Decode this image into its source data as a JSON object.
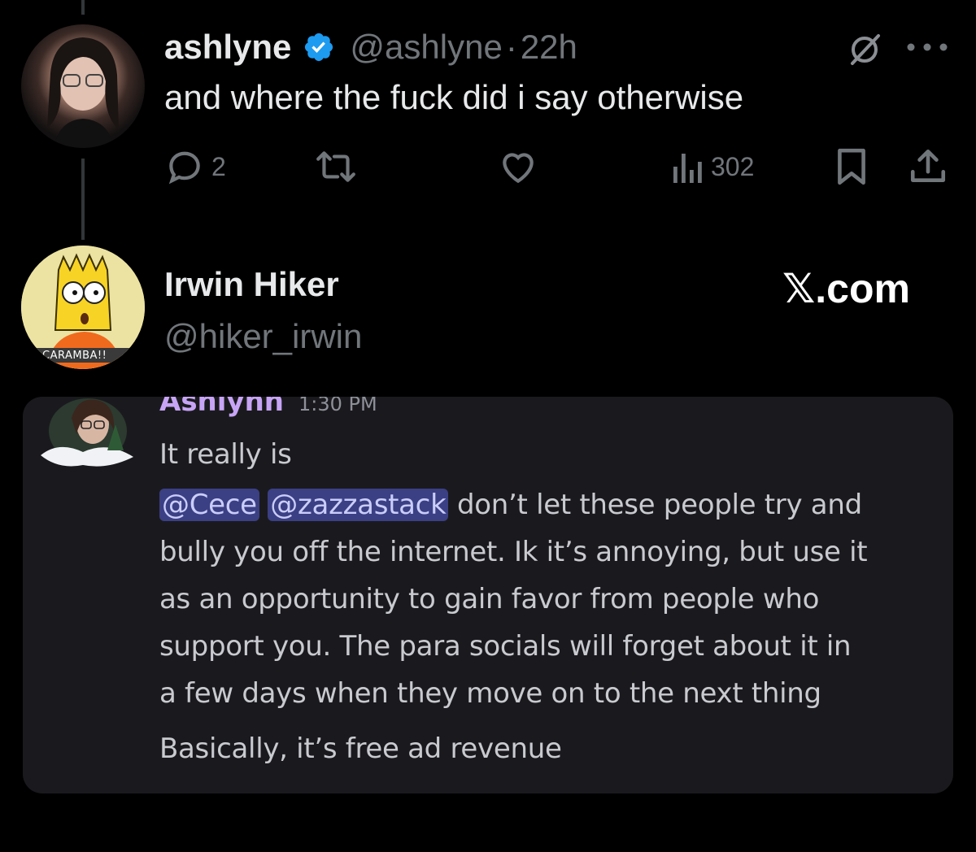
{
  "tweet": {
    "display_name": "ashlyne",
    "handle": "@ashlyne",
    "separator": "·",
    "time": "22h",
    "text": "and where the fuck did i say otherwise",
    "reply_count": "2",
    "view_count": "302",
    "verified": true,
    "colors": {
      "verified": "#1d9bf0",
      "muted": "#71767b",
      "text": "#e7e9ea"
    }
  },
  "embedded": {
    "display_name": "Irwin Hiker",
    "handle": "@hiker_irwin",
    "brand": "𝕏.com",
    "avatar_caption": "CARAMBA!!"
  },
  "discord": {
    "author": "Ashlynn",
    "timestamp": "1:30 PM",
    "lines": [
      "It really is"
    ],
    "mentions": [
      "@Cece",
      "@zazzastack"
    ],
    "line2_rest": " don’t let these people try and",
    "body_lines": [
      "bully you off the internet. Ik it’s annoying, but use it",
      "as an opportunity to gain favor from people who",
      "support you. The para socials will forget about it in",
      "a few days when they move on to the next thing"
    ],
    "last_line": "Basically, it’s free ad revenue",
    "colors": {
      "author": "#c7a4f5",
      "mention_bg": "#3b3f84",
      "card_bg": "#1a1a1e"
    }
  },
  "icons": [
    "reply-icon",
    "retweet-icon",
    "like-icon",
    "views-icon",
    "bookmark-icon",
    "share-icon",
    "grok-icon",
    "more-icon",
    "verified-badge-icon"
  ]
}
